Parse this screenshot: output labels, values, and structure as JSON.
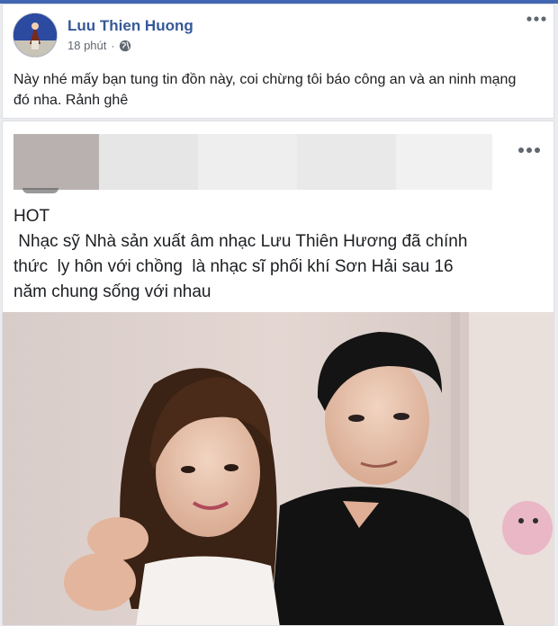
{
  "post": {
    "author": "Luu Thien Huong",
    "time": "18 phút",
    "dot": "·",
    "privacy_icon": "globe-icon",
    "more_icon": "more-options-icon",
    "text": "Này nhé mấy bạn tung tin đồn này, coi chừng tôi báo công an và an ninh mạng đó nha. Rảnh ghê"
  },
  "shared": {
    "more_icon": "more-options-icon",
    "text_lines": [
      "HOT",
      " Nhạc sỹ Nhà sản xuất âm nhạc Lưu Thiên Hương đã chính",
      "thức  ly hôn với chồng  là nhạc sĩ phối khí Sơn Hải sau 16",
      "năm chung sống với nhau"
    ]
  },
  "colors": {
    "link_blue": "#365899",
    "fb_blue": "#4267b2",
    "text": "#1c1e21",
    "secondary": "#606770"
  }
}
